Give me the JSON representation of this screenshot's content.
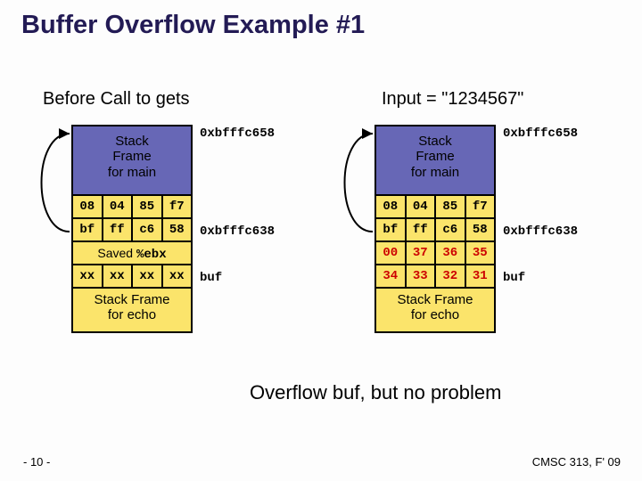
{
  "title": "Buffer Overflow Example #1",
  "subtitleLeft": "Before Call to gets",
  "subtitleRight": "Input = \"1234567\"",
  "addr_top": "0xbfffc658",
  "addr_mid": "0xbfffc638",
  "frameMain_l1": "Stack",
  "frameMain_l2": "Frame",
  "frameMain_l3": "for main",
  "saved_prefix": "Saved ",
  "saved_reg": "%ebx",
  "buf_label": "buf",
  "frameEcho_l1": "Stack Frame",
  "frameEcho_l2": "for echo",
  "left": {
    "r1": [
      "08",
      "04",
      "85",
      "f7"
    ],
    "r2": [
      "bf",
      "ff",
      "c6",
      "58"
    ],
    "r4": [
      "xx",
      "xx",
      "xx",
      "xx"
    ]
  },
  "right": {
    "r1": [
      "08",
      "04",
      "85",
      "f7"
    ],
    "r2": [
      "bf",
      "ff",
      "c6",
      "58"
    ],
    "r3": [
      "00",
      "37",
      "36",
      "35"
    ],
    "r4": [
      "34",
      "33",
      "32",
      "31"
    ]
  },
  "conclusion": "Overflow buf, but no problem",
  "pagenum": "- 10 -",
  "course": "CMSC 313, F' 09"
}
